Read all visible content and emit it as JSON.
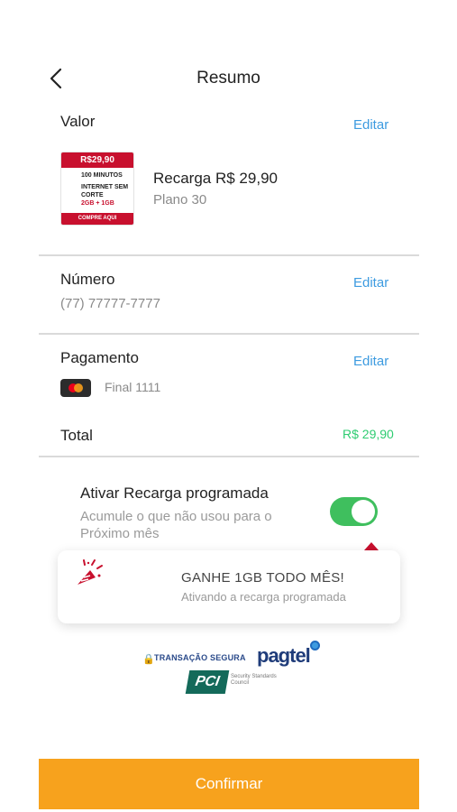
{
  "header": {
    "title": "Resumo"
  },
  "value_section": {
    "label": "Valor",
    "edit_label": "Editar",
    "product": {
      "card_price": "R$29,90",
      "card_line1": "100 MINUTOS",
      "card_line2": "INTERNET SEM CORTE",
      "card_line3": "2GB + 1GB",
      "card_footer": "COMPRE AQUI",
      "name": "Recarga R$ 29,90",
      "plan": "Plano 30"
    }
  },
  "number_section": {
    "label": "Número",
    "edit_label": "Editar",
    "value": "(77) 77777-7777"
  },
  "payment_section": {
    "label": "Pagamento",
    "edit_label": "Editar",
    "card_text": "Final 1111"
  },
  "total": {
    "label": "Total",
    "value": "R$ 29,90"
  },
  "scheduled": {
    "title": "Ativar Recarga programada",
    "description": "Acumule o que não usou para o Próximo mês",
    "enabled": true
  },
  "promo": {
    "title": "GANHE 1GB TODO MÊS!",
    "subtitle": "Ativando a recarga programada"
  },
  "security": {
    "text": "TRANSAÇÃO SEGURA",
    "brand": "pagtel",
    "pci": "PCI",
    "pci_caption": "Security Standards Council"
  },
  "footer": {
    "confirm_label": "Confirmar"
  },
  "colors": {
    "accent_blue": "#3d9be0",
    "confirm_orange": "#f7a21d",
    "total_green": "#2ecc71",
    "toggle_green": "#3fbf5e",
    "brand_red": "#c8102e"
  },
  "icons": {
    "back": "chevron-left-icon",
    "card": "mastercard-icon",
    "promo": "party-popper-icon",
    "lock": "lock-icon"
  }
}
